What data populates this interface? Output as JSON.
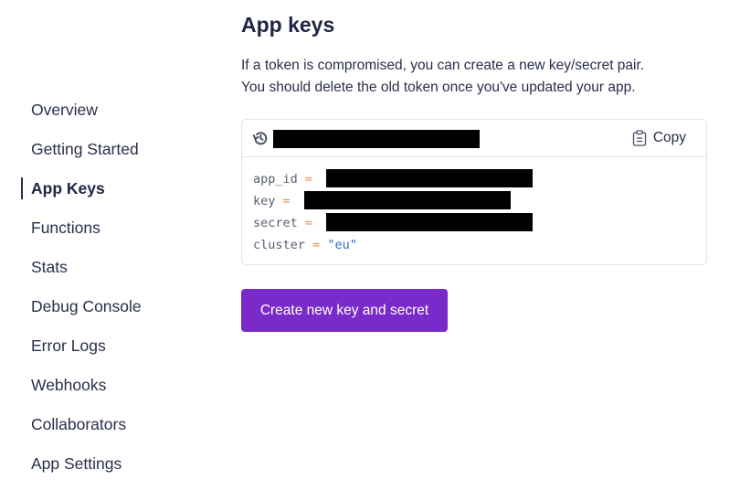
{
  "sidebar": {
    "active_index": 2,
    "items": [
      {
        "label": "Overview"
      },
      {
        "label": "Getting Started"
      },
      {
        "label": "App Keys"
      },
      {
        "label": "Functions"
      },
      {
        "label": "Stats"
      },
      {
        "label": "Debug Console"
      },
      {
        "label": "Error Logs"
      },
      {
        "label": "Webhooks"
      },
      {
        "label": "Collaborators"
      },
      {
        "label": "App Settings"
      }
    ]
  },
  "main": {
    "title": "App keys",
    "description": [
      "If a token is compromised, you can create a new key/secret pair.",
      "You should delete the old token once you've updated your app."
    ],
    "keys_card": {
      "header_icon": "history-icon",
      "header_value": "[redacted]",
      "copy_label": "Copy",
      "copy_icon": "clipboard-icon",
      "code": [
        {
          "key": "app_id",
          "op": "=",
          "value": "[redacted]"
        },
        {
          "key": "key",
          "op": "=",
          "value": "[redacted]"
        },
        {
          "key": "secret",
          "op": "=",
          "value": "[redacted]"
        },
        {
          "key": "cluster",
          "op": "=",
          "value": "\"eu\""
        }
      ]
    },
    "create_button_label": "Create new key and secret"
  },
  "colors": {
    "primary_button": "#7a2ac9",
    "text": "#1f2544",
    "code_operator": "#f08a4b",
    "code_string": "#2f6ac6",
    "border": "#e0e3ec"
  }
}
